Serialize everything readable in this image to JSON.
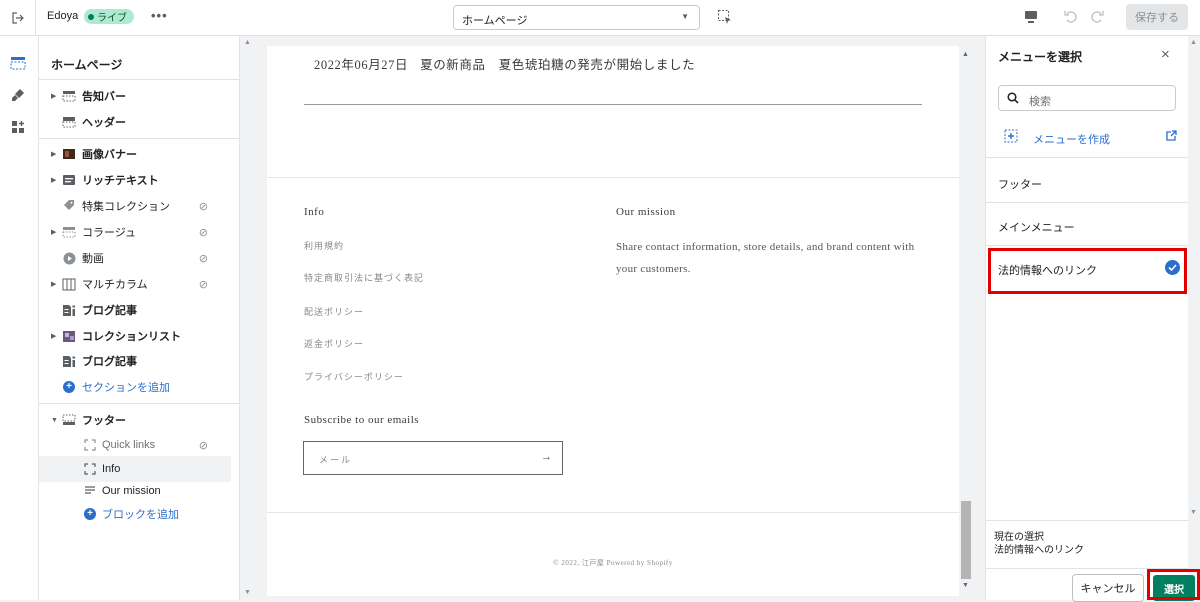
{
  "topbar": {
    "store_name": "Edoya",
    "live_badge": "ライブ",
    "more": "•••",
    "page_select": "ホームページ",
    "save_label": "保存する"
  },
  "sidebar": {
    "title": "ホームページ",
    "items": [
      {
        "label": "告知バー",
        "icon": "announcement-bar-icon",
        "hidden": false
      },
      {
        "label": "ヘッダー",
        "icon": "header-icon",
        "hidden": false
      },
      {
        "label": "画像バナー",
        "icon": "image-banner-icon",
        "hidden": false
      },
      {
        "label": "リッチテキスト",
        "icon": "rich-text-icon",
        "hidden": false
      },
      {
        "label": "特集コレクション",
        "icon": "tag-icon",
        "hidden": true
      },
      {
        "label": "コラージュ",
        "icon": "collage-icon",
        "hidden": true
      },
      {
        "label": "動画",
        "icon": "play-icon",
        "hidden": true
      },
      {
        "label": "マルチカラム",
        "icon": "columns-icon",
        "hidden": true
      },
      {
        "label": "ブログ記事",
        "icon": "blog-icon",
        "hidden": false
      },
      {
        "label": "コレクションリスト",
        "icon": "collection-list-icon",
        "hidden": false
      },
      {
        "label": "ブログ記事",
        "icon": "blog-icon",
        "hidden": false
      }
    ],
    "add_section": "セクションを追加",
    "footer": {
      "label": "フッター",
      "blocks": [
        {
          "label": "Quick links",
          "hidden": true
        },
        {
          "label": "Info",
          "hidden": false
        },
        {
          "label": "Our mission",
          "hidden": false
        }
      ],
      "add_block": "ブロックを追加"
    }
  },
  "preview": {
    "news": {
      "date": "2022年06月27日",
      "title": "夏の新商品　夏色琥珀糖の発売が開始しました"
    },
    "footer": {
      "info_heading": "Info",
      "info_links": [
        "利用規約",
        "特定商取引法に基づく表記",
        "配送ポリシー",
        "返金ポリシー",
        "プライバシーポリシー"
      ],
      "mission_heading": "Our mission",
      "mission_text": "Share contact information, store details, and brand content with your customers.",
      "subscribe_heading": "Subscribe to our emails",
      "email_placeholder": "メール",
      "copyright": "© 2022, 江戸屋 Powered by Shopify"
    }
  },
  "menu_panel": {
    "title": "メニューを選択",
    "search_placeholder": "検索",
    "create_menu": "メニューを作成",
    "menus": [
      "フッター",
      "メインメニュー",
      "法的情報へのリンク"
    ],
    "selected_index": 2,
    "current_label": "現在の選択",
    "current_value": "法的情報へのリンク",
    "cancel": "キャンセル",
    "select": "選択"
  },
  "colors": {
    "accent": "#2c6ecb",
    "primary_button": "#008060",
    "highlight": "#e00000",
    "live_badge": "#aee9d1"
  }
}
